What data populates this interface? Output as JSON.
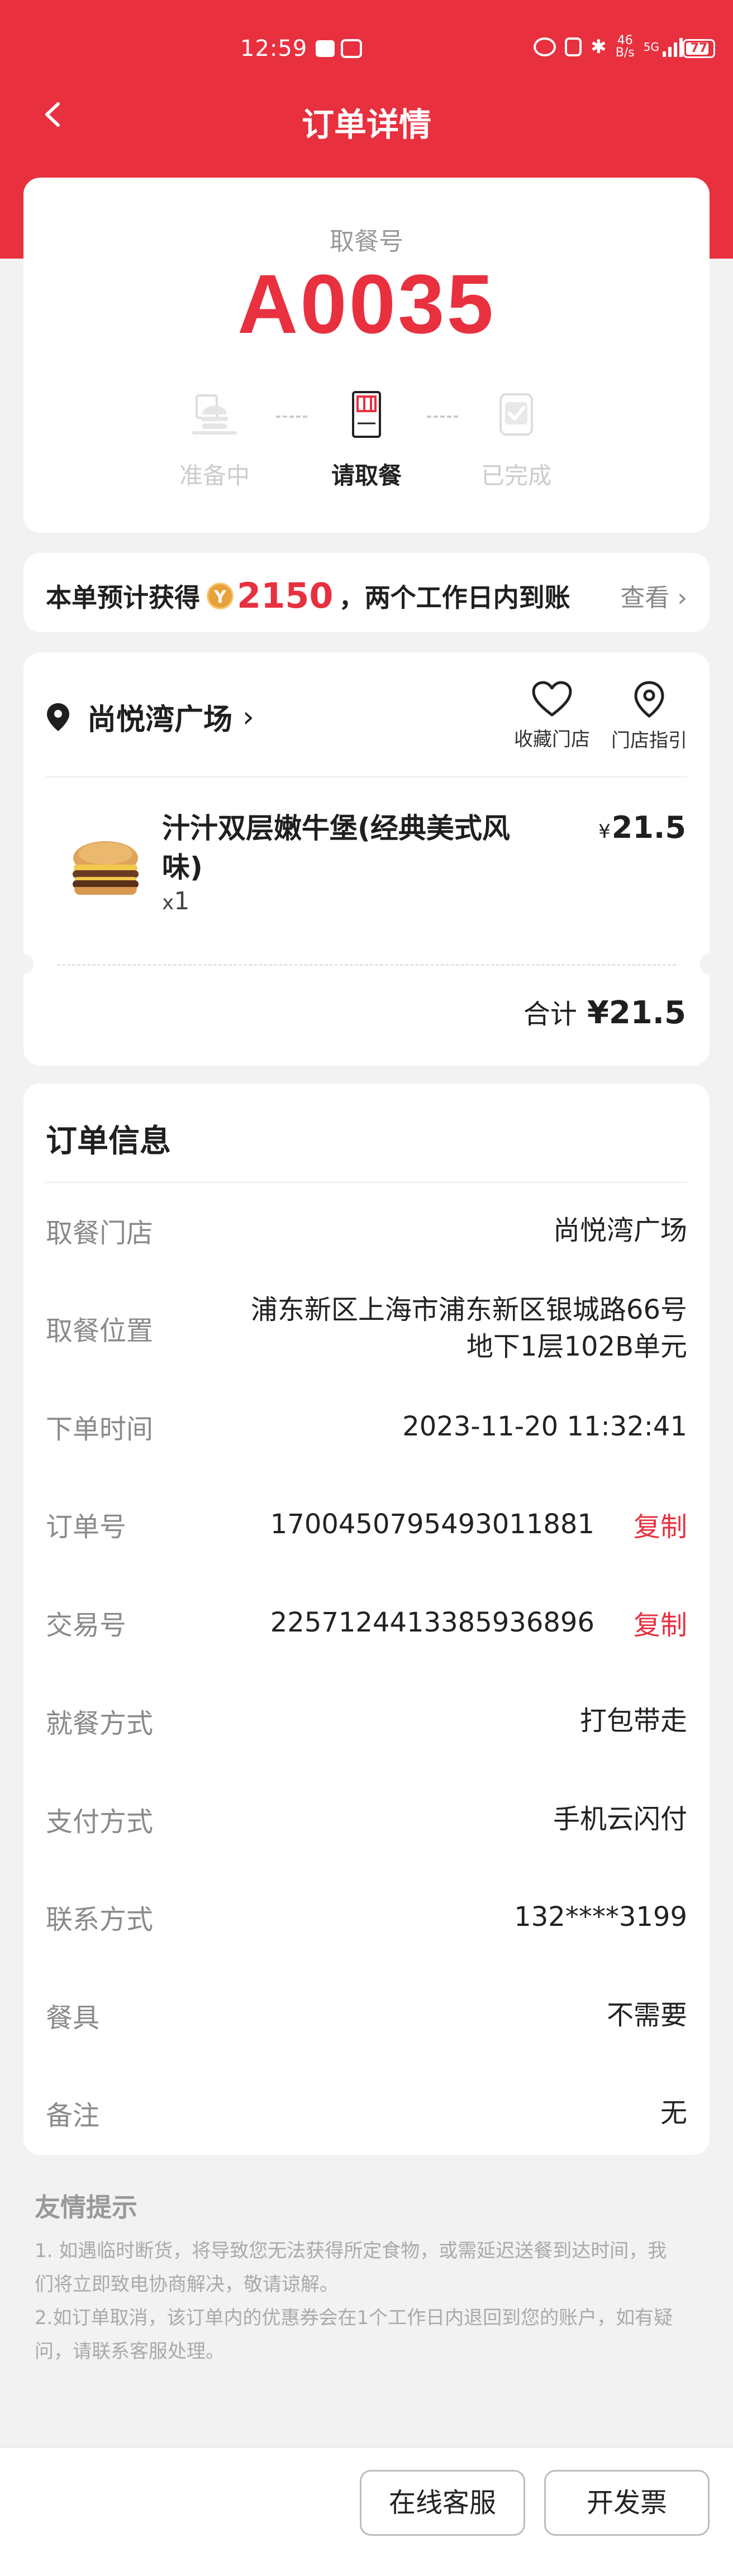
{
  "status_bar": {
    "time": "12:59",
    "net_speed_top": "46",
    "net_speed_bottom": "B/s",
    "signal": "5G",
    "battery": "77"
  },
  "nav": {
    "title": "订单详情"
  },
  "pickup": {
    "label": "取餐号",
    "number": "A0035",
    "steps": [
      {
        "label": "准备中",
        "state": "done"
      },
      {
        "label": "请取餐",
        "state": "active"
      },
      {
        "label": "已完成",
        "state": "pending"
      }
    ]
  },
  "points": {
    "prefix": "本单预计获得",
    "coin_icon": "Y",
    "value": "2150",
    "suffix": "，两个工作日内到账",
    "view_label": "查看",
    "accent_color": "#e8303f"
  },
  "store": {
    "name": "尚悦湾广场",
    "favorite_label": "收藏门店",
    "guide_label": "门店指引",
    "items": [
      {
        "name": "汁汁双层嫩牛堡(经典美式风味)",
        "qty_prefix": "x",
        "qty": "1",
        "currency": "¥",
        "price": "21.5"
      }
    ],
    "total_label": "合计",
    "total_value": "¥21.5"
  },
  "order_info": {
    "title": "订单信息",
    "copy_label": "复制",
    "rows": [
      {
        "key": "取餐门店",
        "value": "尚悦湾广场"
      },
      {
        "key": "取餐位置",
        "value_line1": "浦东新区上海市浦东新区银城路66号",
        "value_line2": "地下1层102B单元"
      },
      {
        "key": "下单时间",
        "value": "2023-11-20 11:32:41"
      },
      {
        "key": "订单号",
        "value": "1700450795493011881"
      },
      {
        "key": "交易号",
        "value": "2257124413385936896"
      },
      {
        "key": "就餐方式",
        "value": "打包带走"
      },
      {
        "key": "支付方式",
        "value": "手机云闪付"
      },
      {
        "key": "联系方式",
        "value": "132****3199"
      },
      {
        "key": "餐具",
        "value": "不需要"
      },
      {
        "key": "备注",
        "value": "无"
      }
    ]
  },
  "tips": {
    "title": "友情提示",
    "line1": "1. 如遇临时断货，将导致您无法获得所定食物，或需延迟送餐到达时间，我",
    "line2": "们将立即致电协商解决，敬请谅解。",
    "line3": "2.如订单取消，该订单内的优惠券会在1个工作日内退回到您的账户，如有疑",
    "line4": "问，请联系客服处理。"
  },
  "buttons": {
    "service": "在线客服",
    "invoice": "开发票"
  }
}
